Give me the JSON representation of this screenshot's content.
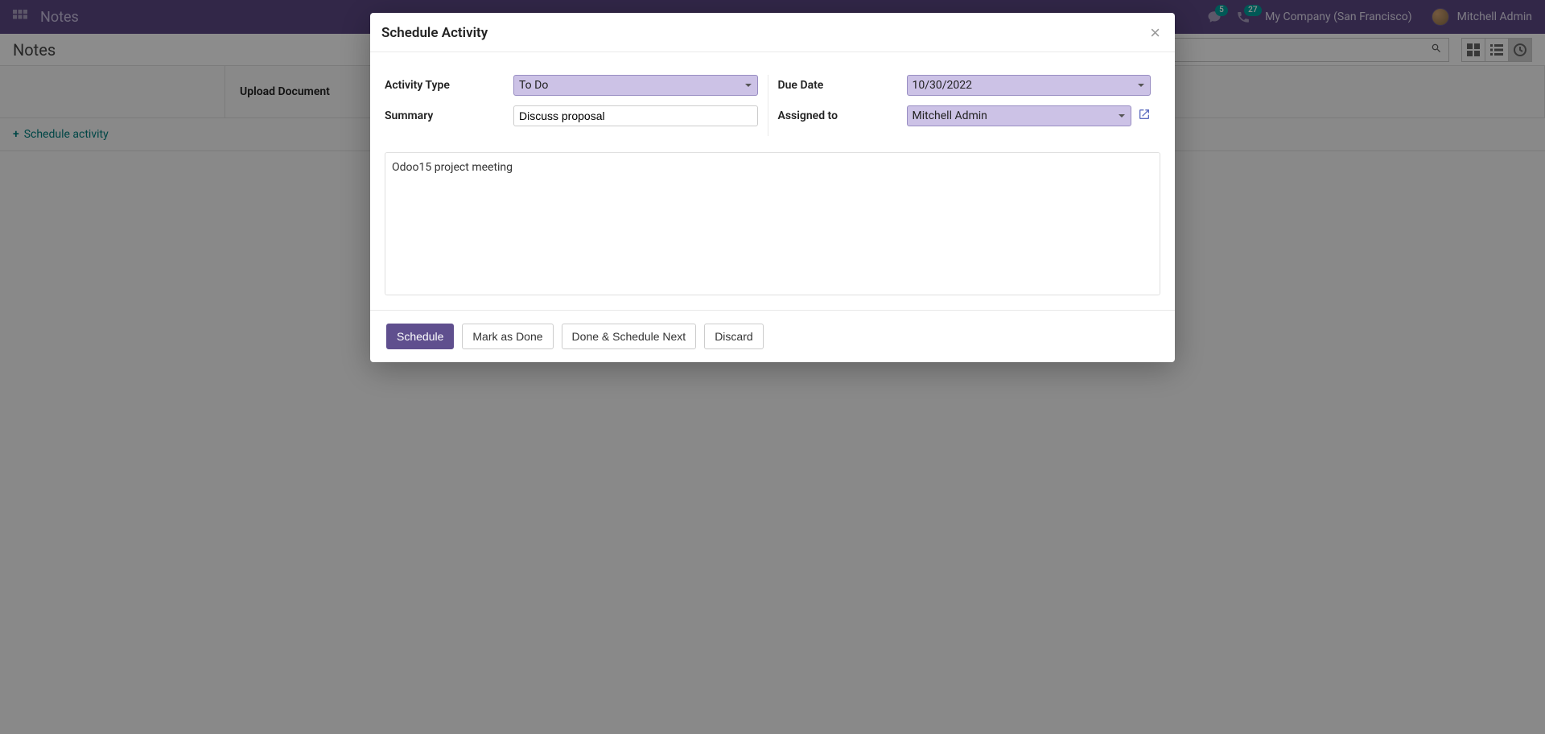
{
  "nav": {
    "app_title": "Notes",
    "comment_count": "5",
    "call_count": "27",
    "company": "My Company (San Francisco)",
    "username": "Mitchell Admin"
  },
  "control": {
    "breadcrumb": "Notes"
  },
  "board": {
    "col2_header": "Upload Document",
    "schedule_label": "Schedule activity"
  },
  "modal": {
    "title": "Schedule Activity",
    "labels": {
      "activity_type": "Activity Type",
      "summary": "Summary",
      "due_date": "Due Date",
      "assigned_to": "Assigned to"
    },
    "values": {
      "activity_type": "To Do",
      "summary": "Discuss proposal",
      "due_date": "10/30/2022",
      "assigned_to": "Mitchell Admin"
    },
    "note_text": "Odoo15 project meeting",
    "buttons": {
      "schedule": "Schedule",
      "mark_done": "Mark as Done",
      "done_next": "Done & Schedule Next",
      "discard": "Discard"
    }
  }
}
